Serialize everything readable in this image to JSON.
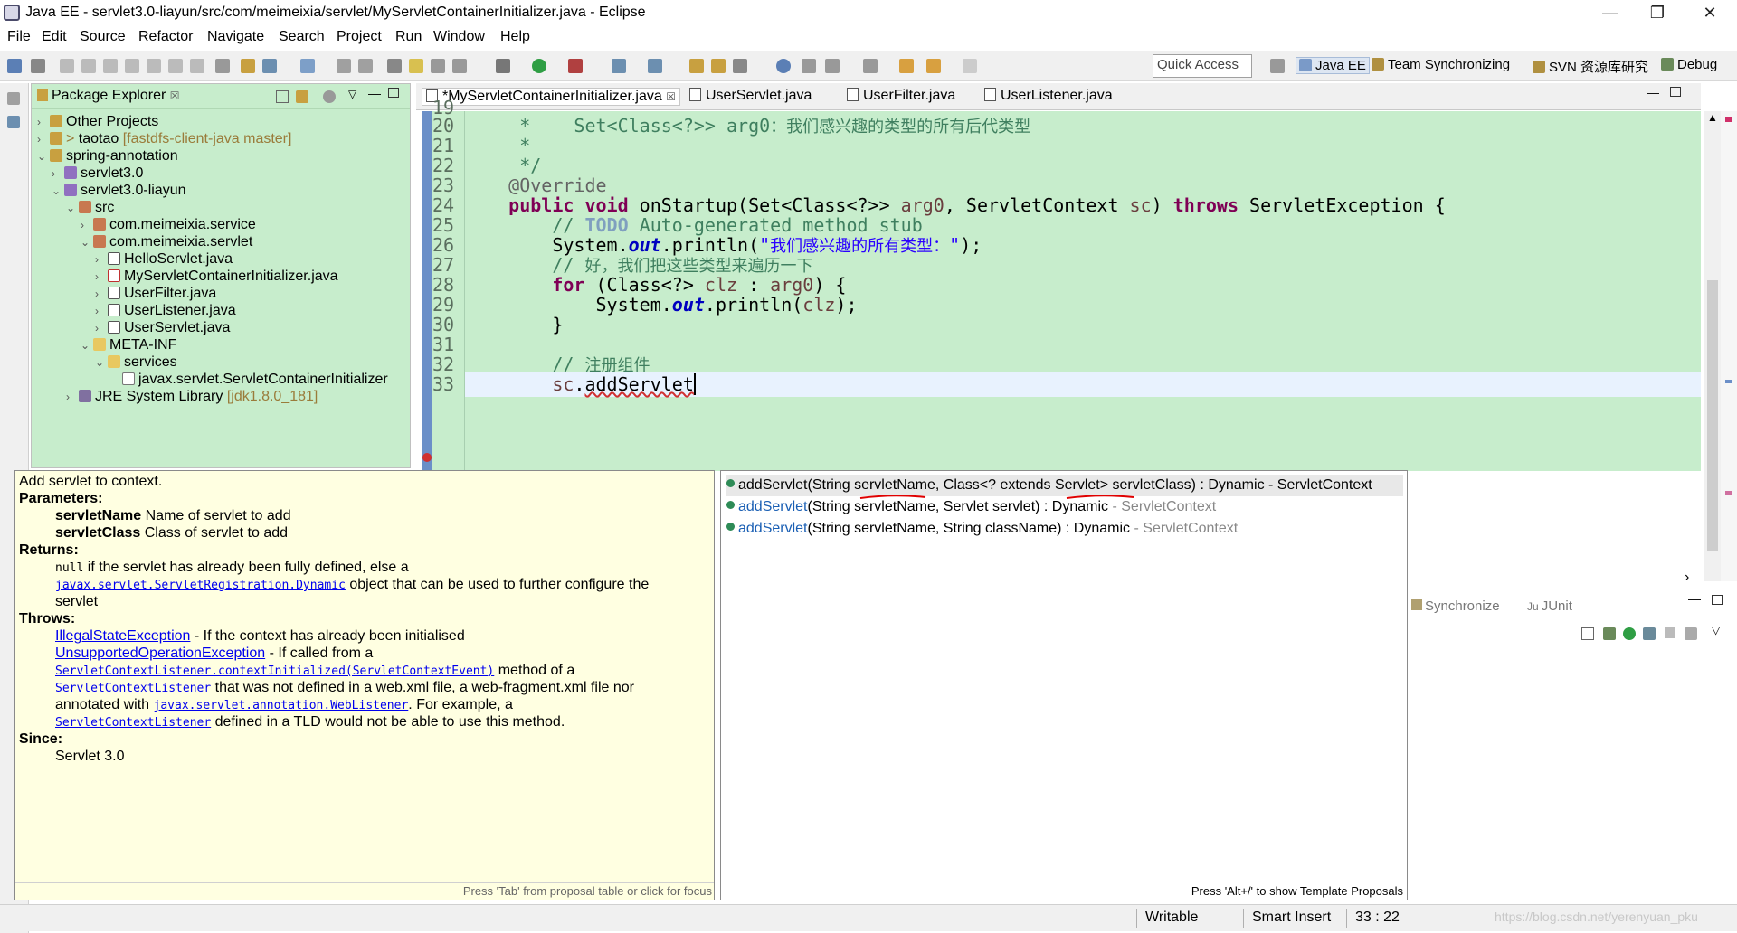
{
  "window": {
    "title": "Java EE - servlet3.0-liayun/src/com/meimeixia/servlet/MyServletContainerInitializer.java - Eclipse",
    "minimize": "—",
    "restore": "❐",
    "close": "✕"
  },
  "menu": [
    "File",
    "Edit",
    "Source",
    "Refactor",
    "Navigate",
    "Search",
    "Project",
    "Run",
    "Window",
    "Help"
  ],
  "toolbar": {
    "quick_access": "Quick Access",
    "perspectives": [
      "Java EE",
      "Team Synchronizing",
      "SVN 资源库研究",
      "Debug"
    ]
  },
  "package_explorer": {
    "title": "Package Explorer",
    "close": "☒",
    "items": [
      {
        "label": "Other Projects",
        "deco": ""
      },
      {
        "label": "taotao",
        "deco": " [fastdfs-client-java master]",
        "prefix": "> "
      },
      {
        "label": "spring-annotation",
        "deco": ""
      },
      {
        "label": "servlet3.0",
        "deco": ""
      },
      {
        "label": "servlet3.0-liayun",
        "deco": ""
      },
      {
        "label": "src",
        "deco": ""
      },
      {
        "label": "com.meimeixia.service",
        "deco": ""
      },
      {
        "label": "com.meimeixia.servlet",
        "deco": ""
      },
      {
        "label": "HelloServlet.java",
        "deco": ""
      },
      {
        "label": "MyServletContainerInitializer.java",
        "deco": ""
      },
      {
        "label": "UserFilter.java",
        "deco": ""
      },
      {
        "label": "UserListener.java",
        "deco": ""
      },
      {
        "label": "UserServlet.java",
        "deco": ""
      },
      {
        "label": "META-INF",
        "deco": ""
      },
      {
        "label": "services",
        "deco": ""
      },
      {
        "label": "javax.servlet.ServletContainerInitializer",
        "deco": ""
      },
      {
        "label": "JRE System Library",
        "deco": " [jdk1.8.0_181]"
      }
    ]
  },
  "editor": {
    "tabs": [
      "*MyServletContainerInitializer.java",
      "UserServlet.java",
      "UserFilter.java",
      "UserListener.java"
    ],
    "line_numbers": [
      "19",
      "20",
      "21",
      "22",
      "23",
      "24",
      "25",
      "26",
      "27",
      "28",
      "29",
      "30",
      "31",
      "32",
      "33"
    ]
  },
  "javadoc": {
    "summary": "Add servlet to context.",
    "parameters_label": "Parameters:",
    "param1_name": "servletName",
    "param1_desc": " Name of servlet to add",
    "param2_name": "servletClass",
    "param2_desc": " Class of servlet to add",
    "returns_label": "Returns:",
    "ret_null": "null",
    "ret_text1": " if the servlet has already been fully defined, else a",
    "ret_link": "javax.servlet.ServletRegistration.Dynamic",
    "ret_text2": " object that can be used to further configure the",
    "ret_text3": "servlet",
    "throws_label": "Throws:",
    "ex1": "IllegalStateException",
    "ex1_text": " - If the context has already been initialised",
    "ex2": "UnsupportedOperationException",
    "ex2_text": " - If called from a",
    "ex2_link1": "ServletContextListener.contextInitialized(ServletContextEvent)",
    "ex2_text2": " method of a",
    "ex2_link2": "ServletContextListener",
    "ex2_text3": " that was not defined in a web.xml file, a web-fragment.xml file nor",
    "ex2_text4": "annotated with ",
    "ex2_link3": "javax.servlet.annotation.WebListener",
    "ex2_text5": ". For example, a",
    "ex2_link4": "ServletContextListener",
    "ex2_text6": " defined in a TLD would not be able to use this method.",
    "since_label": "Since:",
    "since": "Servlet 3.0",
    "footer": "Press 'Tab' from proposal table or click for focus"
  },
  "proposals": {
    "items": [
      {
        "name": "addServlet",
        "args": "(String servletName, Class<? extends Servlet> servletClass) : Dynamic",
        "owner": " - ServletContext"
      },
      {
        "name": "addServlet",
        "args": "(String servletName, Servlet servlet) : Dynamic",
        "owner": " - ServletContext"
      },
      {
        "name": "addServlet",
        "args": "(String servletName, String className) : Dynamic",
        "owner": " - ServletContext"
      }
    ],
    "footer": "Press 'Alt+/' to show Template Proposals"
  },
  "bottom_panel": {
    "tabs": [
      "Synchronize",
      "JUnit"
    ]
  },
  "status": {
    "mode": "Writable",
    "insert": "Smart Insert",
    "position": "33 : 22",
    "watermark": "https://blog.csdn.net/yerenyuan_pku"
  },
  "colors": {
    "editor_bg": "#c7edcc",
    "keyword": "#7f0055",
    "comment": "#3f7f5f",
    "string": "#2a00ff",
    "javadoc_bg": "#ffffe1"
  }
}
